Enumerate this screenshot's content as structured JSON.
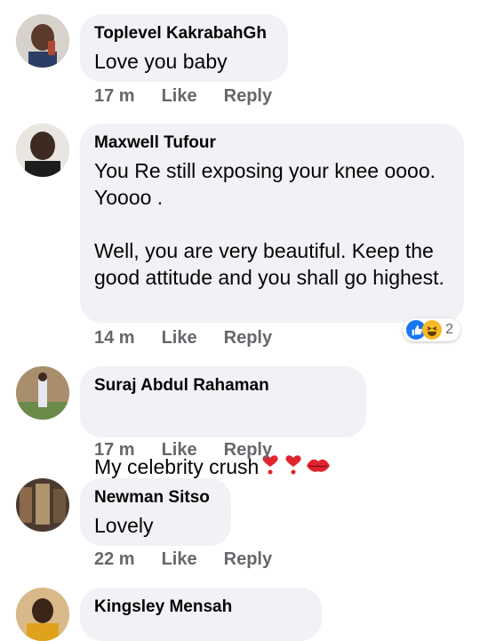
{
  "comments": [
    {
      "name": "Toplevel KakrabahGh",
      "text": "Love you baby",
      "time": "17 m",
      "like": "Like",
      "reply": "Reply"
    },
    {
      "name": "Maxwell Tufour",
      "text": "You Re still exposing your knee oooo. Yoooo .\n\nWell, you are very beautiful. Keep the good attitude and you shall go highest.",
      "time": "14 m",
      "like": "Like",
      "reply": "Reply",
      "reaction_count": "2"
    },
    {
      "name": "Suraj Abdul Rahaman",
      "text": "My celebrity crush",
      "time": "17 m",
      "like": "Like",
      "reply": "Reply"
    },
    {
      "name": "Newman Sitso",
      "text": "Lovely",
      "time": "22 m",
      "like": "Like",
      "reply": "Reply"
    },
    {
      "name": "Kingsley Mensah"
    }
  ],
  "icons": {
    "reactions": [
      "like-icon",
      "haha-icon"
    ],
    "emojis": [
      "heart-exclamation-icon",
      "heart-exclamation-icon",
      "kiss-mark-icon"
    ]
  },
  "colors": {
    "bubble": "#f0f2f5",
    "meta": "#65676b",
    "like_blue": "#1877f2",
    "haha_yellow": "#f7b928",
    "heart_red": "#e0242f"
  }
}
